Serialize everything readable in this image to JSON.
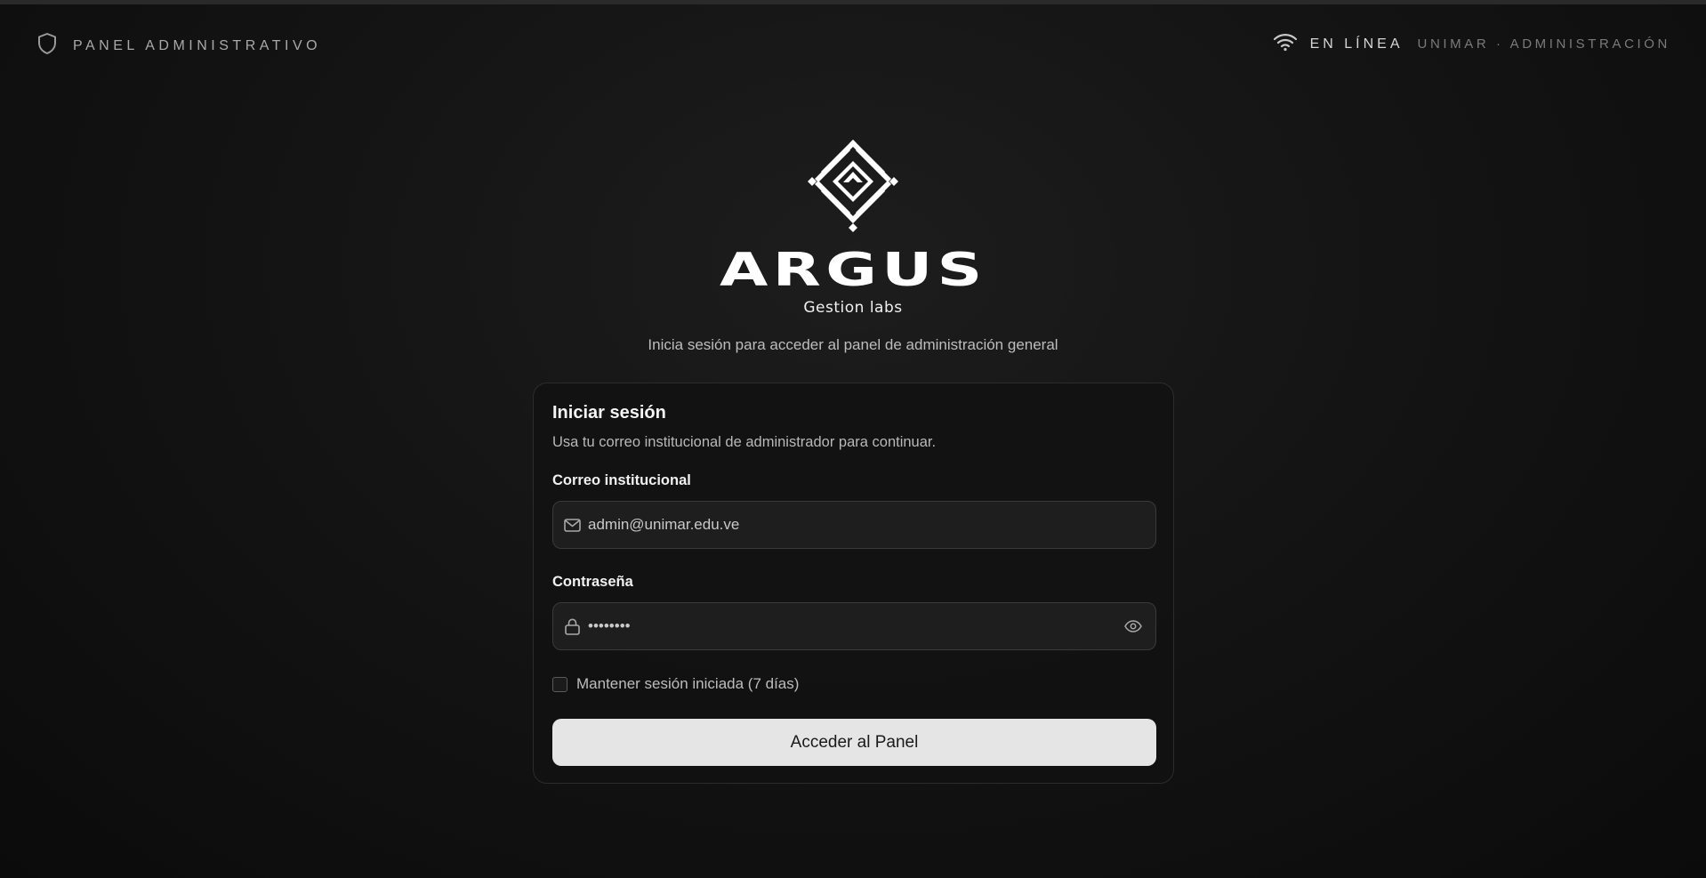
{
  "header": {
    "left_label": "PANEL ADMINISTRATIVO",
    "status": "EN LÍNEA",
    "org": "UNIMAR · ADMINISTRACIÓN"
  },
  "brand": {
    "name": "ARGUS",
    "tagline": "Gestion labs"
  },
  "subtitle": "Inicia sesión para acceder al panel de administración general",
  "login_card": {
    "title": "Iniciar sesión",
    "description": "Usa tu correo institucional de administrador para continuar.",
    "email_label": "Correo institucional",
    "email_value": "admin@unimar.edu.ve",
    "password_label": "Contraseña",
    "password_value": "••••••••",
    "remember_label": "Mantener sesión iniciada (7 días)",
    "remember_checked": false,
    "submit_label": "Acceder al Panel"
  },
  "icons": {
    "header_left": "shield-icon",
    "header_right": "wifi-icon",
    "email": "mail-icon",
    "password": "lock-icon",
    "toggle_password": "eye-icon"
  },
  "colors": {
    "background": "#111111",
    "card_background": "#121212",
    "input_background": "#1e1e1e",
    "button_background": "#e5e5e5",
    "button_text": "#1a1a1a"
  }
}
